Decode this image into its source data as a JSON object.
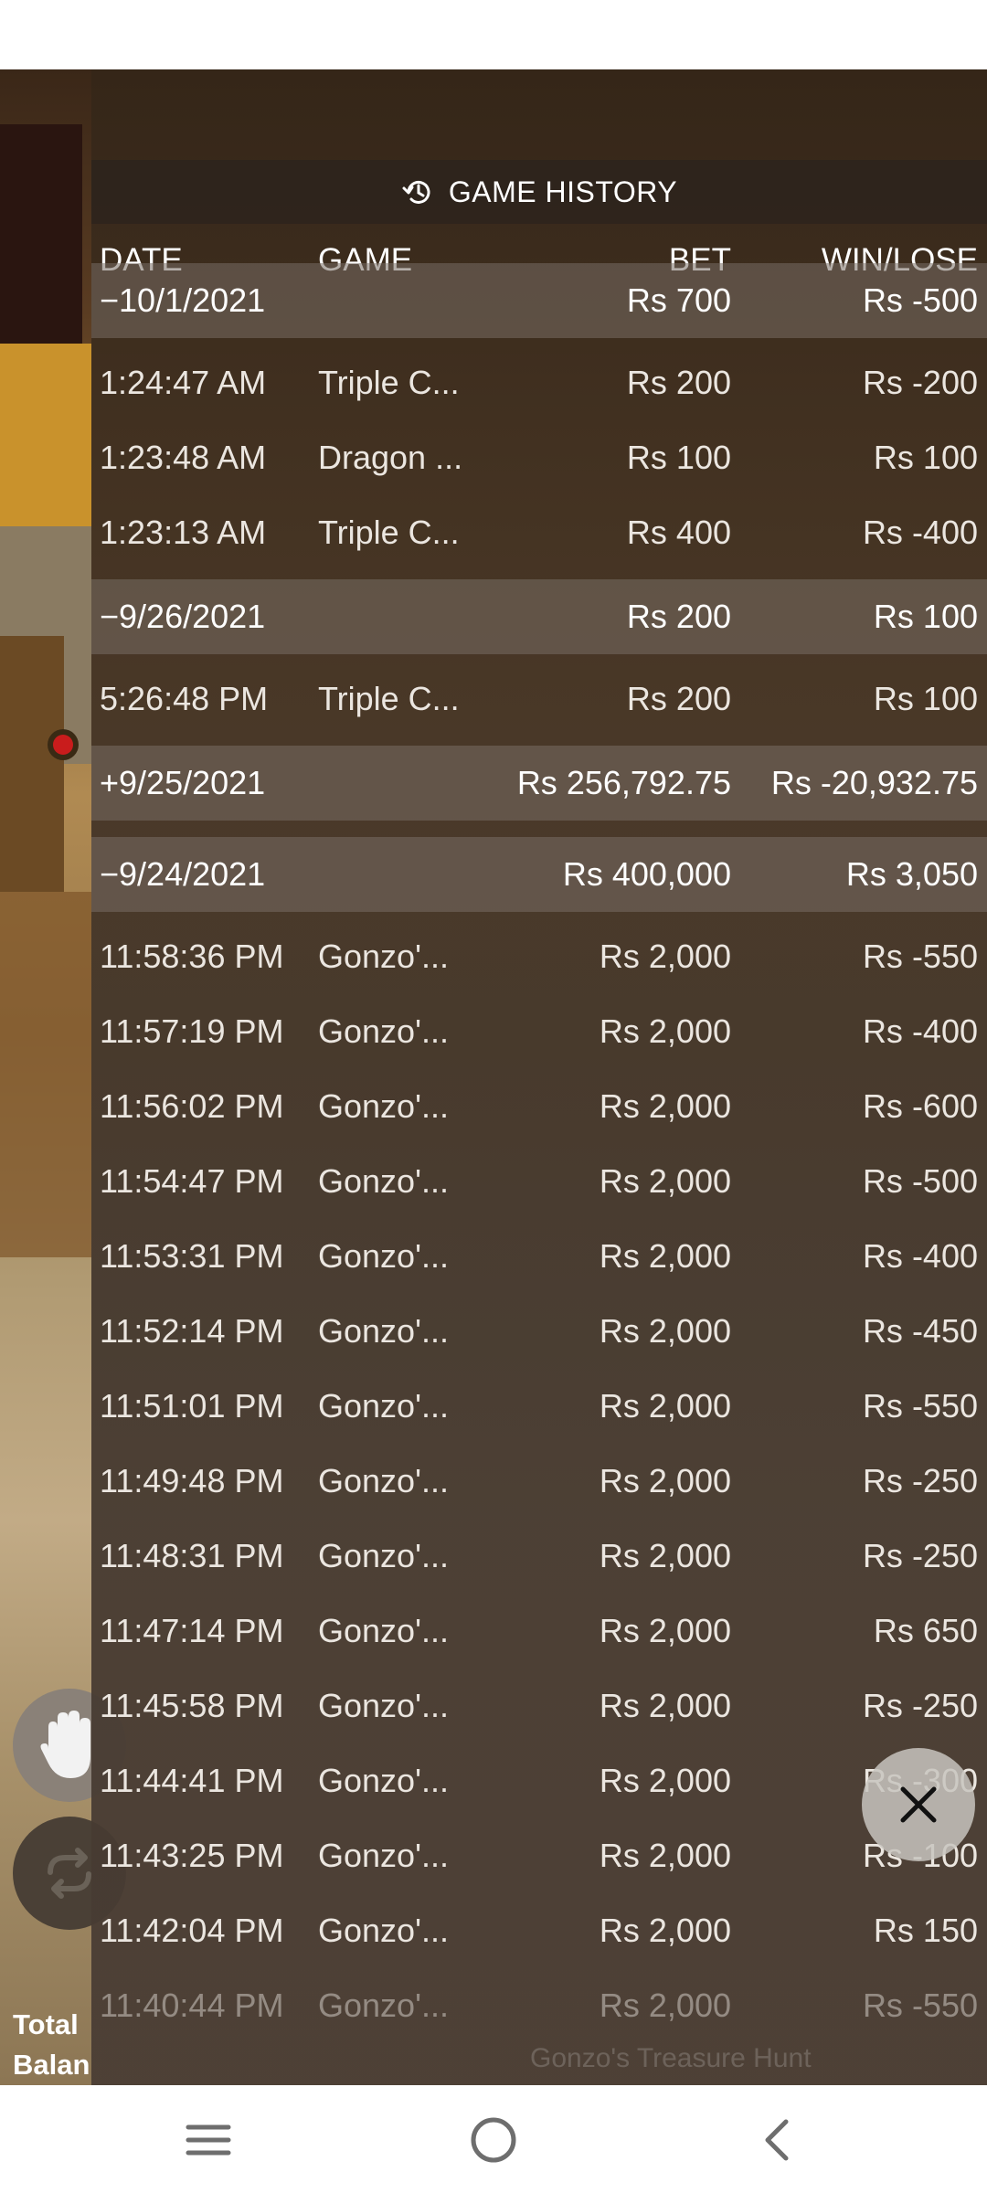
{
  "panel": {
    "title": "GAME HISTORY",
    "columns": {
      "date": "DATE",
      "game": "GAME",
      "bet": "BET",
      "win": "WIN/LOSE"
    }
  },
  "rows": [
    {
      "type": "group",
      "date": "−10/1/2021",
      "game": "",
      "bet": "Rs 700",
      "win": "Rs -500"
    },
    {
      "type": "item",
      "date": "1:24:47 AM",
      "game": "Triple C...",
      "bet": "Rs 200",
      "win": "Rs -200"
    },
    {
      "type": "item",
      "date": "1:23:48 AM",
      "game": "Dragon ...",
      "bet": "Rs 100",
      "win": "Rs 100"
    },
    {
      "type": "item",
      "date": "1:23:13 AM",
      "game": "Triple C...",
      "bet": "Rs 400",
      "win": "Rs -400"
    },
    {
      "type": "group",
      "date": "−9/26/2021",
      "game": "",
      "bet": "Rs 200",
      "win": "Rs 100"
    },
    {
      "type": "item",
      "date": "5:26:48 PM",
      "game": "Triple C...",
      "bet": "Rs 200",
      "win": "Rs 100"
    },
    {
      "type": "group",
      "date": "+9/25/2021",
      "game": "",
      "bet": "Rs 256,792.75",
      "win": "Rs -20,932.75"
    },
    {
      "type": "group",
      "date": "−9/24/2021",
      "game": "",
      "bet": "Rs 400,000",
      "win": "Rs 3,050"
    },
    {
      "type": "item",
      "date": "11:58:36 PM",
      "game": "Gonzo'...",
      "bet": "Rs 2,000",
      "win": "Rs -550"
    },
    {
      "type": "item",
      "date": "11:57:19 PM",
      "game": "Gonzo'...",
      "bet": "Rs 2,000",
      "win": "Rs -400"
    },
    {
      "type": "item",
      "date": "11:56:02 PM",
      "game": "Gonzo'...",
      "bet": "Rs 2,000",
      "win": "Rs -600"
    },
    {
      "type": "item",
      "date": "11:54:47 PM",
      "game": "Gonzo'...",
      "bet": "Rs 2,000",
      "win": "Rs -500"
    },
    {
      "type": "item",
      "date": "11:53:31 PM",
      "game": "Gonzo'...",
      "bet": "Rs 2,000",
      "win": "Rs -400"
    },
    {
      "type": "item",
      "date": "11:52:14 PM",
      "game": "Gonzo'...",
      "bet": "Rs 2,000",
      "win": "Rs -450"
    },
    {
      "type": "item",
      "date": "11:51:01 PM",
      "game": "Gonzo'...",
      "bet": "Rs 2,000",
      "win": "Rs -550"
    },
    {
      "type": "item",
      "date": "11:49:48 PM",
      "game": "Gonzo'...",
      "bet": "Rs 2,000",
      "win": "Rs -250"
    },
    {
      "type": "item",
      "date": "11:48:31 PM",
      "game": "Gonzo'...",
      "bet": "Rs 2,000",
      "win": "Rs -250"
    },
    {
      "type": "item",
      "date": "11:47:14 PM",
      "game": "Gonzo'...",
      "bet": "Rs 2,000",
      "win": "Rs 650"
    },
    {
      "type": "item",
      "date": "11:45:58 PM",
      "game": "Gonzo'...",
      "bet": "Rs 2,000",
      "win": "Rs -250"
    },
    {
      "type": "item",
      "date": "11:44:41 PM",
      "game": "Gonzo'...",
      "bet": "Rs 2,000",
      "win": "Rs -300"
    },
    {
      "type": "item",
      "date": "11:43:25 PM",
      "game": "Gonzo'...",
      "bet": "Rs 2,000",
      "win": "Rs -100"
    },
    {
      "type": "item",
      "date": "11:42:04 PM",
      "game": "Gonzo'...",
      "bet": "Rs 2,000",
      "win": "Rs 150"
    },
    {
      "type": "item",
      "date": "11:40:44 PM",
      "game": "Gonzo'...",
      "bet": "Rs 2,000",
      "win": "Rs -550",
      "faded": true
    }
  ],
  "balance_label": "Total\nBalan",
  "watermark": "Gonzo's Treasure Hunt",
  "icons": {
    "history": "history-icon",
    "close": "close-icon",
    "hand": "hand-icon",
    "repeat": "repeat-icon",
    "nav_menu": "menu-icon",
    "nav_home": "home-icon",
    "nav_back": "back-icon"
  }
}
